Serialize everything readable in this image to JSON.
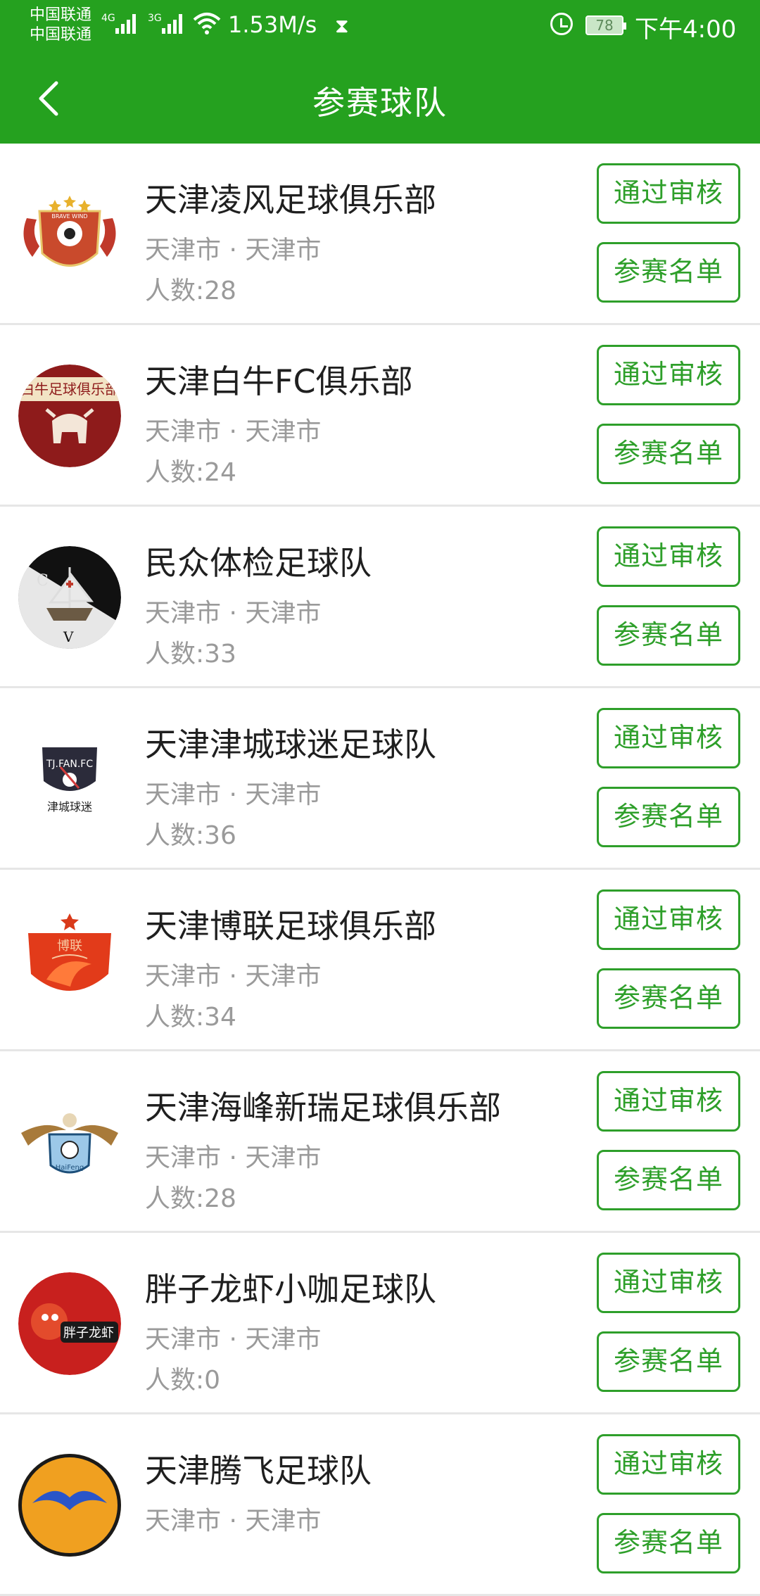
{
  "status_bar": {
    "carrier_1": "中国联通",
    "carrier_2": "中国联通",
    "net_1": "4G",
    "net_2": "3G",
    "speed": "1.53M/s",
    "battery": "78",
    "time": "下午4:00"
  },
  "header": {
    "title": "参赛球队",
    "back_icon": "chevron-left-icon",
    "color": "#25a11f"
  },
  "accent_color": "#2e9f2a",
  "teams": [
    {
      "name": "天津凌风足球俱乐部",
      "city": "天津市 · 天津市",
      "count": "人数:28",
      "approve_label": "通过审核",
      "roster_label": "参赛名单",
      "logo_text": "BRAVE WIND"
    },
    {
      "name": "天津白牛FC俱乐部",
      "city": "天津市 · 天津市",
      "count": "人数:24",
      "approve_label": "通过审核",
      "roster_label": "参赛名单",
      "logo_text": "白牛足球俱乐部"
    },
    {
      "name": "民众体检足球队",
      "city": "天津市 · 天津市",
      "count": "人数:33",
      "approve_label": "通过审核",
      "roster_label": "参赛名单",
      "logo_text": ""
    },
    {
      "name": "天津津城球迷足球队",
      "city": "天津市 · 天津市",
      "count": "人数:36",
      "approve_label": "通过审核",
      "roster_label": "参赛名单",
      "logo_text": "TJ.FAN.FC"
    },
    {
      "name": "天津博联足球俱乐部",
      "city": "天津市 · 天津市",
      "count": "人数:34",
      "approve_label": "通过审核",
      "roster_label": "参赛名单",
      "logo_text": "博联"
    },
    {
      "name": "天津海峰新瑞足球俱乐部",
      "city": "天津市 · 天津市",
      "count": "人数:28",
      "approve_label": "通过审核",
      "roster_label": "参赛名单",
      "logo_text": "HaiFeng"
    },
    {
      "name": "胖子龙虾小咖足球队",
      "city": "天津市 · 天津市",
      "count": "人数:0",
      "approve_label": "通过审核",
      "roster_label": "参赛名单",
      "logo_text": "胖子龙虾"
    },
    {
      "name": "天津腾飞足球队",
      "city": "天津市 · 天津市",
      "count": "",
      "approve_label": "通过审核",
      "roster_label": "参赛名单",
      "logo_text": ""
    }
  ]
}
